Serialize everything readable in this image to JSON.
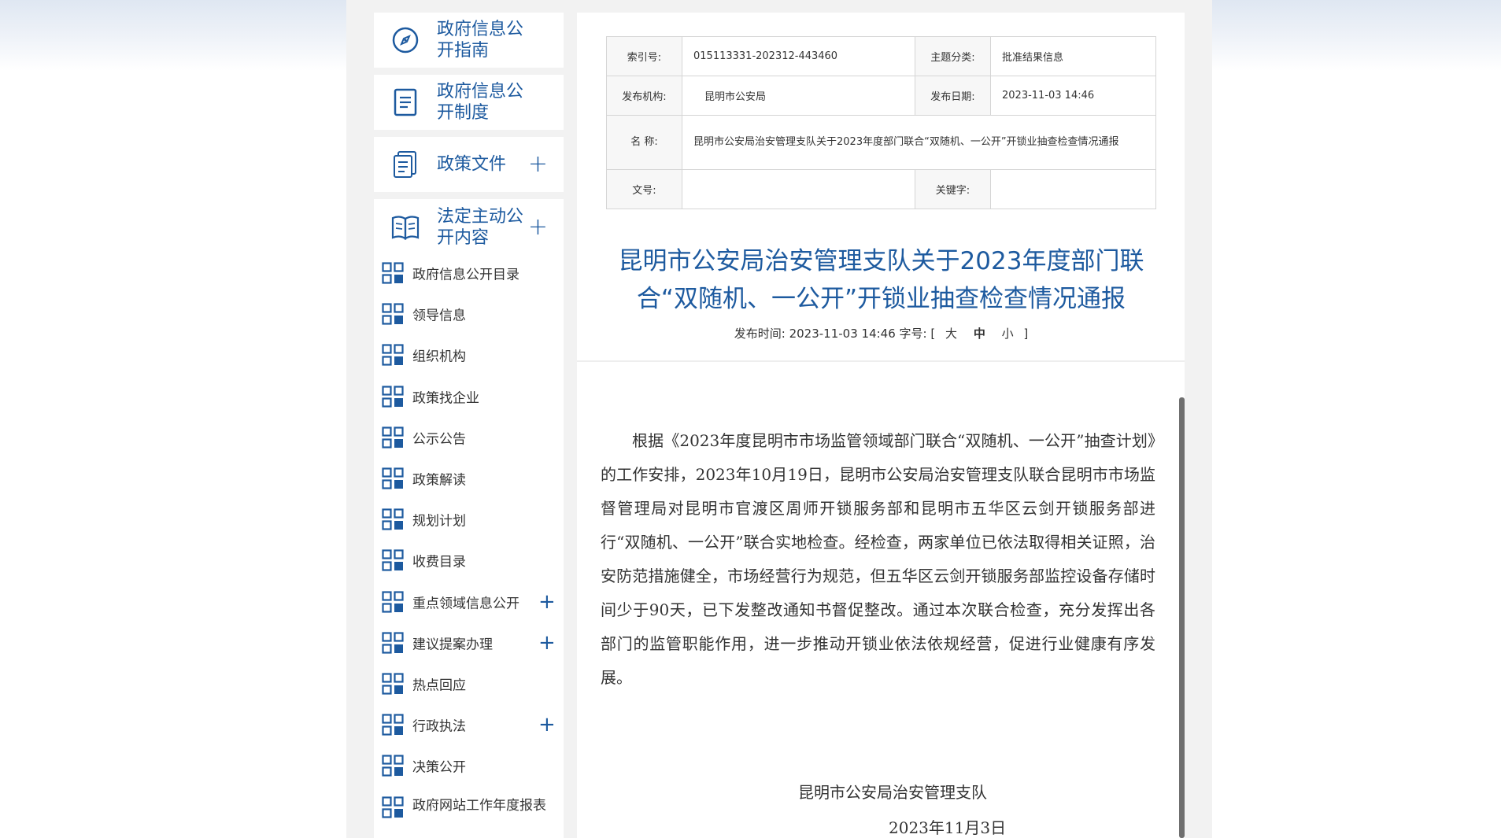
{
  "sidebar": {
    "cards": [
      {
        "label": "政府信息公开指南",
        "icon": "compass-icon",
        "has_plus": false
      },
      {
        "label": "政府信息公开制度",
        "icon": "document-list-icon",
        "has_plus": false
      },
      {
        "label": "政策文件",
        "icon": "file-stack-icon",
        "has_plus": true
      },
      {
        "label": "法定主动公开内容",
        "icon": "open-book-icon",
        "has_plus": true
      }
    ],
    "plus_symbol": "+",
    "items": [
      {
        "label": "政府信息公开目录",
        "has_plus": false
      },
      {
        "label": "领导信息",
        "has_plus": false
      },
      {
        "label": "组织机构",
        "has_plus": false
      },
      {
        "label": "政策找企业",
        "has_plus": false
      },
      {
        "label": "公示公告",
        "has_plus": false
      },
      {
        "label": "政策解读",
        "has_plus": false
      },
      {
        "label": "规划计划",
        "has_plus": false
      },
      {
        "label": "收费目录",
        "has_plus": false
      },
      {
        "label": "重点领域信息公开",
        "has_plus": true
      },
      {
        "label": "建议提案办理",
        "has_plus": true
      },
      {
        "label": "热点回应",
        "has_plus": false
      },
      {
        "label": "行政执法",
        "has_plus": true
      },
      {
        "label": "决策公开",
        "has_plus": false
      },
      {
        "label": "政府网站工作年度报表",
        "has_plus": false
      }
    ],
    "item_icon": "grid-icon",
    "accent_color": "#1d5a9f"
  },
  "meta": {
    "index_label": "索引号:",
    "index_value": "015113331-202312-443460",
    "topic_label": "主题分类:",
    "topic_value": "批准结果信息",
    "publisher_label": "发布机构:",
    "publisher_value": "昆明市公安局",
    "pubdate_label": "发布日期:",
    "pubdate_value": "2023-11-03 14:46",
    "name_label": "名 称:",
    "name_value": "昆明市公安局治安管理支队关于2023年度部门联合“双随机、一公开”开锁业抽查检查情况通报",
    "docno_label": "文号:",
    "docno_value": "",
    "keyword_label": "关键字:",
    "keyword_value": ""
  },
  "article": {
    "title_line1": "昆明市公安局治安管理支队关于2023年度部门联",
    "title_line2": "合“双随机、一公开”开锁业抽查检查情况通报",
    "pub_prefix": "发布时间:",
    "pub_time": "2023-11-03 14:46",
    "font_size_label": "字号:",
    "bracket_open": "[",
    "size_large": "大",
    "size_medium": "中",
    "size_small": "小",
    "bracket_close": "]",
    "body": "根据《2023年度昆明市市场监管领域部门联合“双随机、一公开”抽查计划》的工作安排，2023年10月19日，昆明市公安局治安管理支队联合昆明市市场监督管理局对昆明市官渡区周师开锁服务部和昆明市五华区云剑开锁服务部进行“双随机、一公开”联合实地检查。经检查，两家单位已依法取得相关证照，治安防范措施健全，市场经营行为规范，但五华区云剑开锁服务部监控设备存储时间少于90天，已下发整改通知书督促整改。通过本次联合检查，充分发挥出各部门的监管职能作用，进一步推动开锁业依法依规经营，促进行业健康有序发展。",
    "sign_org": "昆明市公安局治安管理支队",
    "sign_date": "2023年11月3日",
    "title_color": "#1d5a9f"
  }
}
